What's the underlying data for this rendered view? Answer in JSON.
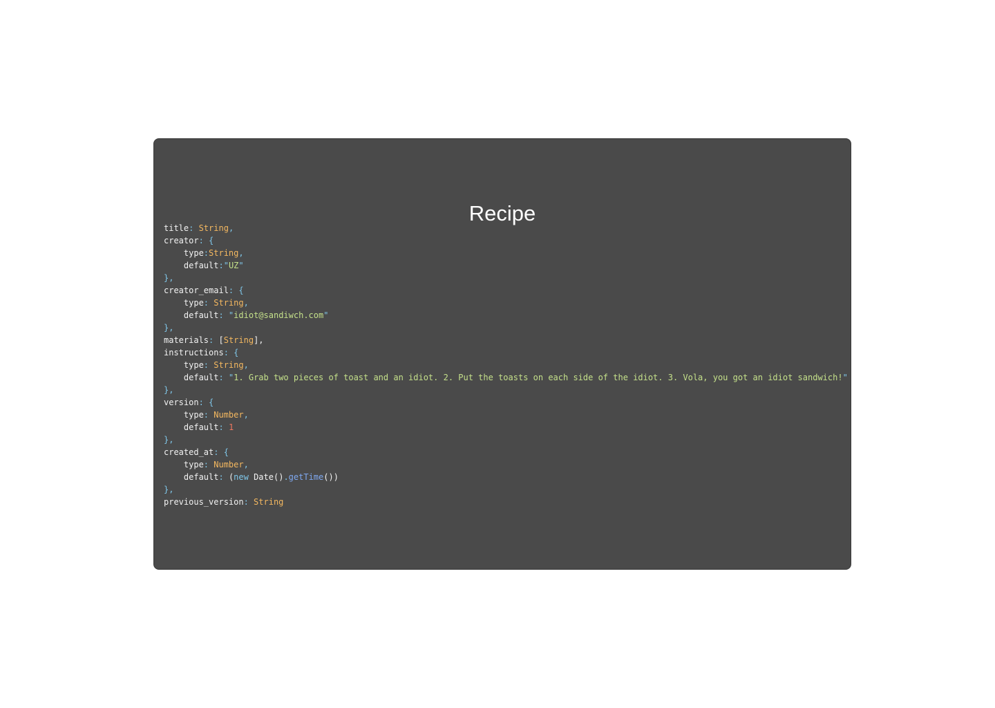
{
  "title": "Recipe",
  "code_lines": [
    [
      {
        "t": "title",
        "c": "key"
      },
      {
        "t": ": ",
        "c": "punc"
      },
      {
        "t": "String",
        "c": "type"
      },
      {
        "t": ",",
        "c": "punc"
      }
    ],
    [
      {
        "t": "creator",
        "c": "key"
      },
      {
        "t": ": {",
        "c": "punc"
      }
    ],
    [
      {
        "t": "    type",
        "c": "key"
      },
      {
        "t": ":",
        "c": "punc"
      },
      {
        "t": "String",
        "c": "type"
      },
      {
        "t": ",",
        "c": "punc"
      }
    ],
    [
      {
        "t": "    default",
        "c": "key"
      },
      {
        "t": ":\"",
        "c": "punc"
      },
      {
        "t": "UZ",
        "c": "str"
      },
      {
        "t": "\"",
        "c": "quote"
      }
    ],
    [
      {
        "t": "},",
        "c": "punc"
      }
    ],
    [
      {
        "t": "creator_email",
        "c": "key"
      },
      {
        "t": ": {",
        "c": "punc"
      }
    ],
    [
      {
        "t": "    type",
        "c": "key"
      },
      {
        "t": ": ",
        "c": "punc"
      },
      {
        "t": "String",
        "c": "type"
      },
      {
        "t": ",",
        "c": "punc"
      }
    ],
    [
      {
        "t": "    default",
        "c": "key"
      },
      {
        "t": ": \"",
        "c": "punc"
      },
      {
        "t": "idiot@sandiwch.com",
        "c": "str"
      },
      {
        "t": "\"",
        "c": "quote"
      }
    ],
    [
      {
        "t": "},",
        "c": "punc"
      }
    ],
    [
      {
        "t": "materials",
        "c": "key"
      },
      {
        "t": ": ",
        "c": "punc"
      },
      {
        "t": "[",
        "c": "plain"
      },
      {
        "t": "String",
        "c": "type"
      },
      {
        "t": "],",
        "c": "plain"
      }
    ],
    [
      {
        "t": "instructions",
        "c": "key"
      },
      {
        "t": ": {",
        "c": "punc"
      }
    ],
    [
      {
        "t": "    type",
        "c": "key"
      },
      {
        "t": ": ",
        "c": "punc"
      },
      {
        "t": "String",
        "c": "type"
      },
      {
        "t": ",",
        "c": "punc"
      }
    ],
    [
      {
        "t": "    default",
        "c": "key"
      },
      {
        "t": ": \"",
        "c": "punc"
      },
      {
        "t": "1. Grab two pieces of toast and an idiot. 2. Put the toasts on each side of the idiot. 3. Vola, you got an idiot sandwich!",
        "c": "str"
      },
      {
        "t": "\"",
        "c": "quote"
      }
    ],
    [
      {
        "t": "},",
        "c": "punc"
      }
    ],
    [
      {
        "t": "version",
        "c": "key"
      },
      {
        "t": ": {",
        "c": "punc"
      }
    ],
    [
      {
        "t": "    type",
        "c": "key"
      },
      {
        "t": ": ",
        "c": "punc"
      },
      {
        "t": "Number",
        "c": "type"
      },
      {
        "t": ",",
        "c": "punc"
      }
    ],
    [
      {
        "t": "    default",
        "c": "key"
      },
      {
        "t": ": ",
        "c": "punc"
      },
      {
        "t": "1",
        "c": "num"
      }
    ],
    [
      {
        "t": "},",
        "c": "punc"
      }
    ],
    [
      {
        "t": "created_at",
        "c": "key"
      },
      {
        "t": ": {",
        "c": "punc"
      }
    ],
    [
      {
        "t": "    type",
        "c": "key"
      },
      {
        "t": ": ",
        "c": "punc"
      },
      {
        "t": "Number",
        "c": "type"
      },
      {
        "t": ",",
        "c": "punc"
      }
    ],
    [
      {
        "t": "    default",
        "c": "key"
      },
      {
        "t": ": ",
        "c": "punc"
      },
      {
        "t": "(",
        "c": "plain"
      },
      {
        "t": "new",
        "c": "kw"
      },
      {
        "t": " Date()",
        "c": "plain"
      },
      {
        "t": ".",
        "c": "punc"
      },
      {
        "t": "getTime",
        "c": "fn"
      },
      {
        "t": "())",
        "c": "plain"
      }
    ],
    [
      {
        "t": "},",
        "c": "punc"
      }
    ],
    [
      {
        "t": "previous_version",
        "c": "key"
      },
      {
        "t": ": ",
        "c": "punc"
      },
      {
        "t": "String",
        "c": "type"
      }
    ]
  ]
}
